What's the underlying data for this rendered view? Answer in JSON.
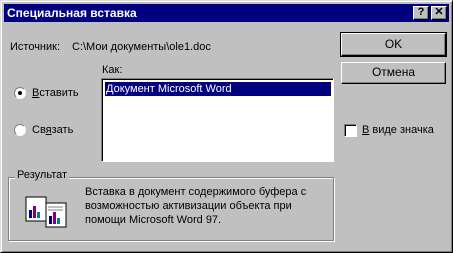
{
  "window": {
    "title": "Специальная вставка",
    "help": "?",
    "close": "✕"
  },
  "source": {
    "label": "Источник:",
    "path": "C:\\Мои документы\\ole1.doc"
  },
  "as_label": "Как:",
  "formats": [
    "Документ Microsoft Word"
  ],
  "options": {
    "paste": {
      "label_hot": "В",
      "label_rest": "ставить",
      "selected": true
    },
    "link": {
      "label_pre": "Св",
      "label_hot": "я",
      "label_rest": "зать",
      "selected": false
    }
  },
  "buttons": {
    "ok": "OK",
    "cancel": "Отмена"
  },
  "as_icon": {
    "label_hot": "В",
    "label_rest": " виде значка",
    "checked": false
  },
  "result": {
    "label": "Результат",
    "line1": "Вставка в документ содержимого буфера с",
    "line2": "возможностью активизации объекта при",
    "line3": "помощи Microsoft Word 97."
  },
  "icon": "paste-result-icon"
}
